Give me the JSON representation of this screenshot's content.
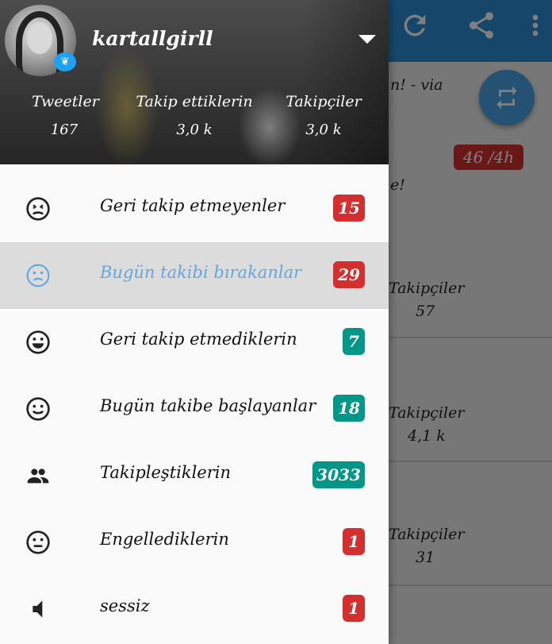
{
  "background": {
    "partial_text_1": "n! - via",
    "badge": "46 /4h",
    "partial_text_2": "e!",
    "rows": [
      {
        "label": "Takipçiler",
        "value": "57"
      },
      {
        "label": "Takipçiler",
        "value": "4,1 k"
      },
      {
        "label": "Takipçiler",
        "value": "31"
      }
    ],
    "toolbar_icons": [
      "refresh-icon",
      "share-icon",
      "more-vert-icon"
    ],
    "fab_icon": "repeat-icon"
  },
  "profile": {
    "username": "kartallgirll",
    "stats": [
      {
        "label": "Tweetler",
        "value": "167"
      },
      {
        "label": "Takip ettiklerin",
        "value": "3,0 k"
      },
      {
        "label": "Takipçiler",
        "value": "3,0 k"
      }
    ]
  },
  "menu": {
    "items": [
      {
        "label": "Geri takip etmeyenler",
        "badge": "15",
        "icon": "sad-face-icon",
        "badge_color": "#d32f2f"
      },
      {
        "label": "Bugün takibi bırakanlar",
        "badge": "29",
        "icon": "frown-face-icon",
        "badge_color": "#d32f2f",
        "active": true
      },
      {
        "label": "Geri takip etmediklerin",
        "badge": "7",
        "icon": "happy-face-icon",
        "badge_color": "#009688"
      },
      {
        "label": "Bugün takibe başlayanlar",
        "badge": "18",
        "icon": "smile-face-icon",
        "badge_color": "#009688"
      },
      {
        "label": "Takipleştiklerin",
        "badge": "3033",
        "icon": "people-icon",
        "badge_color": "#009688"
      },
      {
        "label": "Engellediklerin",
        "badge": "1",
        "icon": "neutral-face-icon",
        "badge_color": "#d32f2f"
      },
      {
        "label": "sessiz",
        "badge": "1",
        "icon": "volume-mute-icon",
        "badge_color": "#d32f2f"
      }
    ]
  },
  "colors": {
    "accent": "#2d8fd6",
    "active_label": "#64a7dc",
    "badge_red": "#d32f2f",
    "badge_teal": "#009688"
  }
}
